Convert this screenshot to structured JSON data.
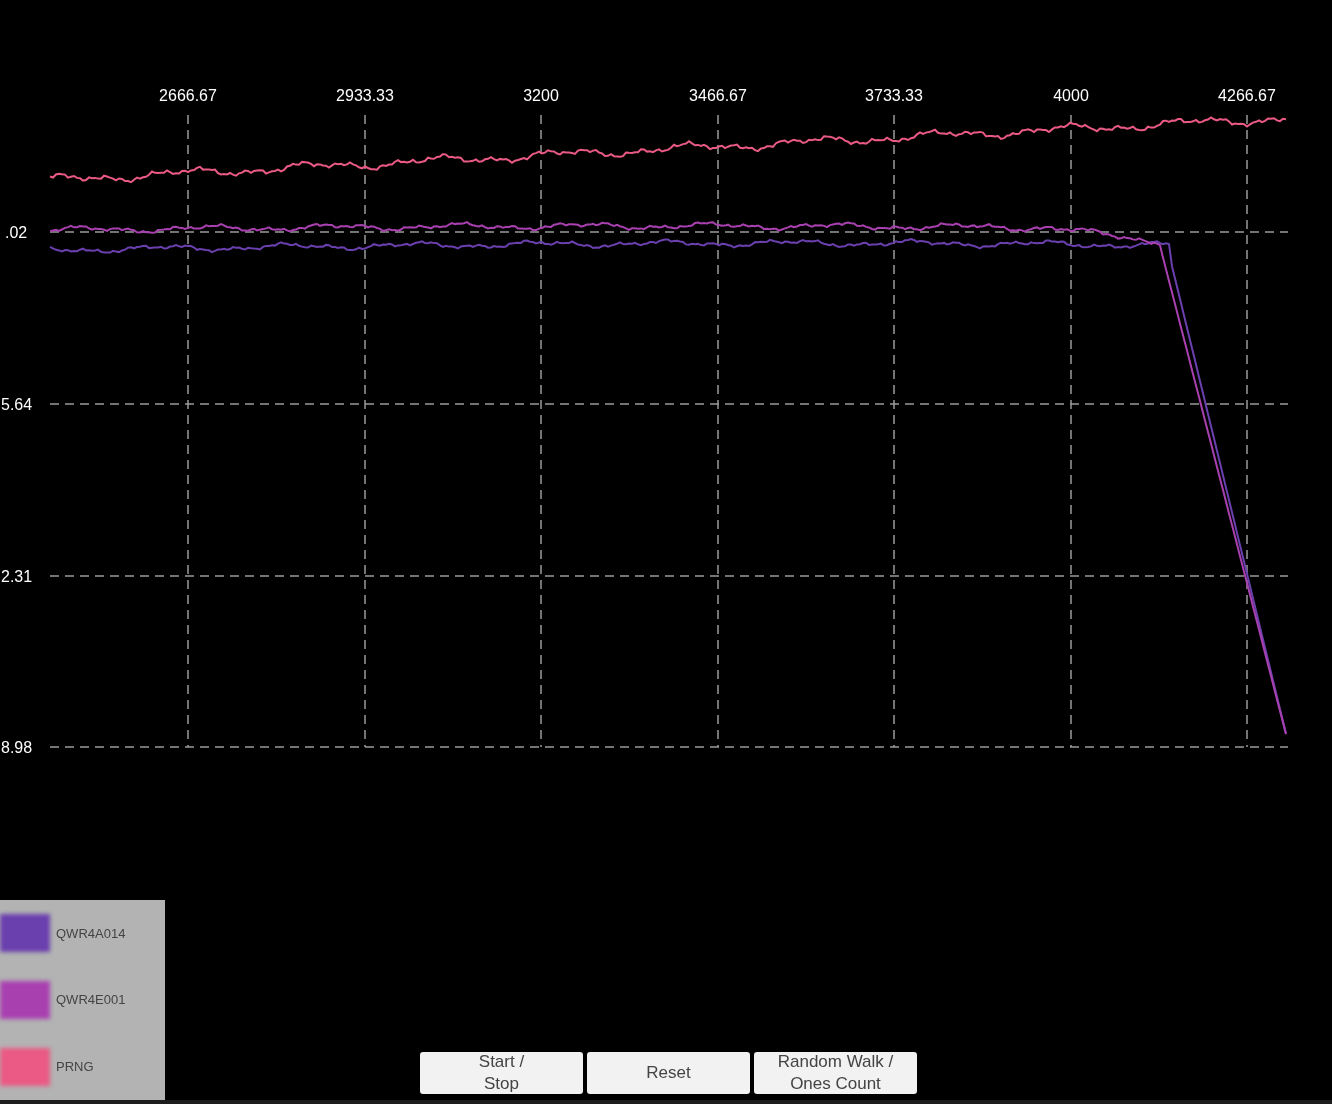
{
  "plot": {
    "x_axis_labels": [
      "2666.67",
      "2933.33",
      "3200",
      "3466.67",
      "3733.33",
      "4000",
      "4266.67"
    ],
    "y_axis_labels": [
      ".02",
      "5.64",
      "2.31",
      "8.98"
    ]
  },
  "legend": [
    {
      "name": "QWR4A014",
      "color": "#6a3fae"
    },
    {
      "name": "QWR4E001",
      "color": "#a940b0"
    },
    {
      "name": "PRNG",
      "color": "#ea5a85"
    }
  ],
  "buttons": [
    {
      "lines": [
        "Start /",
        "Stop"
      ]
    },
    {
      "lines": [
        "Reset"
      ]
    },
    {
      "lines": [
        "Random Walk /",
        "Ones Count"
      ]
    }
  ]
}
